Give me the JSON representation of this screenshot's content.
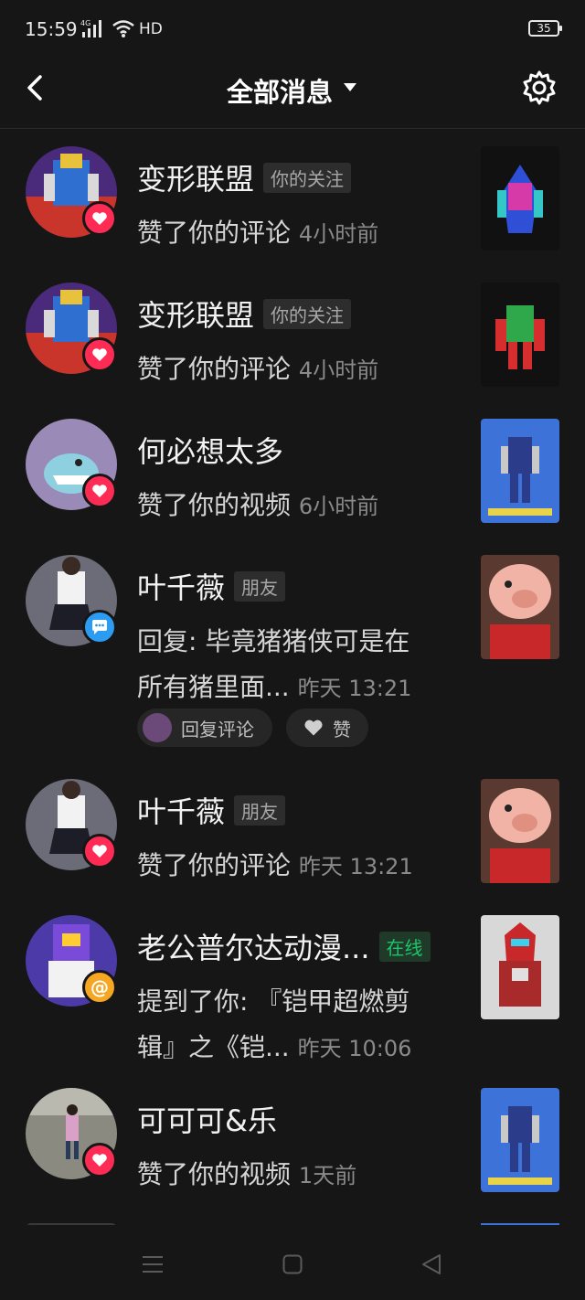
{
  "status": {
    "time": "15:59",
    "network": "4G",
    "hd": "HD",
    "battery": "35"
  },
  "nav": {
    "title": "全部消息"
  },
  "messages": [
    {
      "name": "变形联盟",
      "tag": "你的关注",
      "action": "赞了你的评论",
      "time": "4小时前",
      "badge": "heart-icon"
    },
    {
      "name": "变形联盟",
      "tag": "你的关注",
      "action": "赞了你的评论",
      "time": "4小时前",
      "badge": "heart-icon"
    },
    {
      "name": "何必想太多",
      "action": "赞了你的视频",
      "time": "6小时前",
      "badge": "heart-icon"
    },
    {
      "name": "叶千薇",
      "tag": "朋友",
      "action_line1": "回复: 毕竟猪猪侠可是在",
      "action_line2": "所有猪里面...",
      "time": "昨天 13:21",
      "badge": "comment-icon",
      "reply_label": "回复评论",
      "like_label": "赞"
    },
    {
      "name": "叶千薇",
      "tag": "朋友",
      "action": "赞了你的评论",
      "time": "昨天 13:21",
      "badge": "heart-icon"
    },
    {
      "name": "老公普尔达动漫...",
      "tag": "在线",
      "action_line1": "提到了你: 『铠甲超燃剪",
      "action_line2": "辑』之《铠...",
      "time": "昨天 10:06",
      "badge": "at-icon"
    },
    {
      "name": "可可可&乐",
      "action": "赞了你的视频",
      "time": "1天前",
      "badge": "heart-icon"
    }
  ],
  "colors": {
    "background": "#161616",
    "like": "#fe2c55",
    "comment": "#2b9cf2",
    "mention": "#f5a623",
    "online": "#1ec46a"
  }
}
